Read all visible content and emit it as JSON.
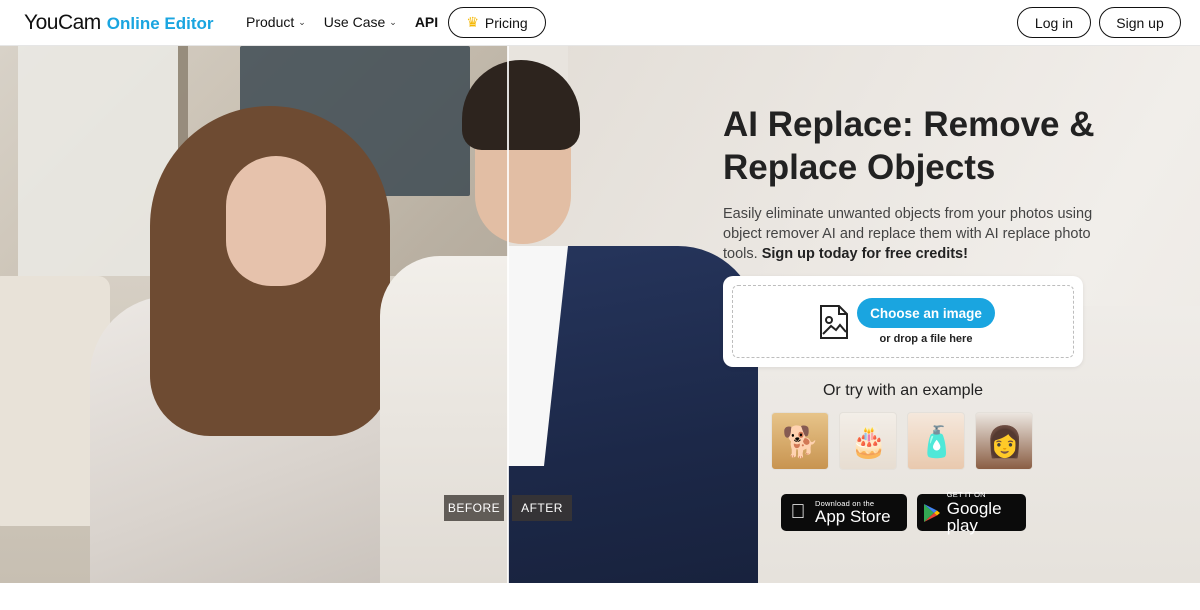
{
  "header": {
    "logo_brand": "YouCam",
    "logo_product": "Online Editor",
    "nav": {
      "product": "Product",
      "use_case": "Use Case",
      "api": "API"
    },
    "pricing_label": "Pricing",
    "login_label": "Log in",
    "signup_label": "Sign up"
  },
  "hero": {
    "before_label": "BEFORE",
    "after_label": "AFTER",
    "title": "AI Replace: Remove & Replace Objects",
    "description": "Easily eliminate unwanted objects from your photos using object remover AI and replace them with AI replace photo tools.",
    "description_cta": "Sign up today for free credits!",
    "upload": {
      "button_label": "Choose an image",
      "drop_text": "or drop a file here"
    },
    "examples_title": "Or try with an example",
    "examples": [
      {
        "icon": "dog-icon"
      },
      {
        "icon": "cake-icon"
      },
      {
        "icon": "cosmetics-icon"
      },
      {
        "icon": "portrait-icon"
      }
    ],
    "app_store": {
      "small": "Download on the",
      "big": "App Store"
    },
    "google_play": {
      "small": "GET IT ON",
      "big": "Google play"
    }
  },
  "colors": {
    "accent": "#1aa5e0",
    "crown": "#f5b700",
    "store_bg": "#0b0b0b"
  }
}
